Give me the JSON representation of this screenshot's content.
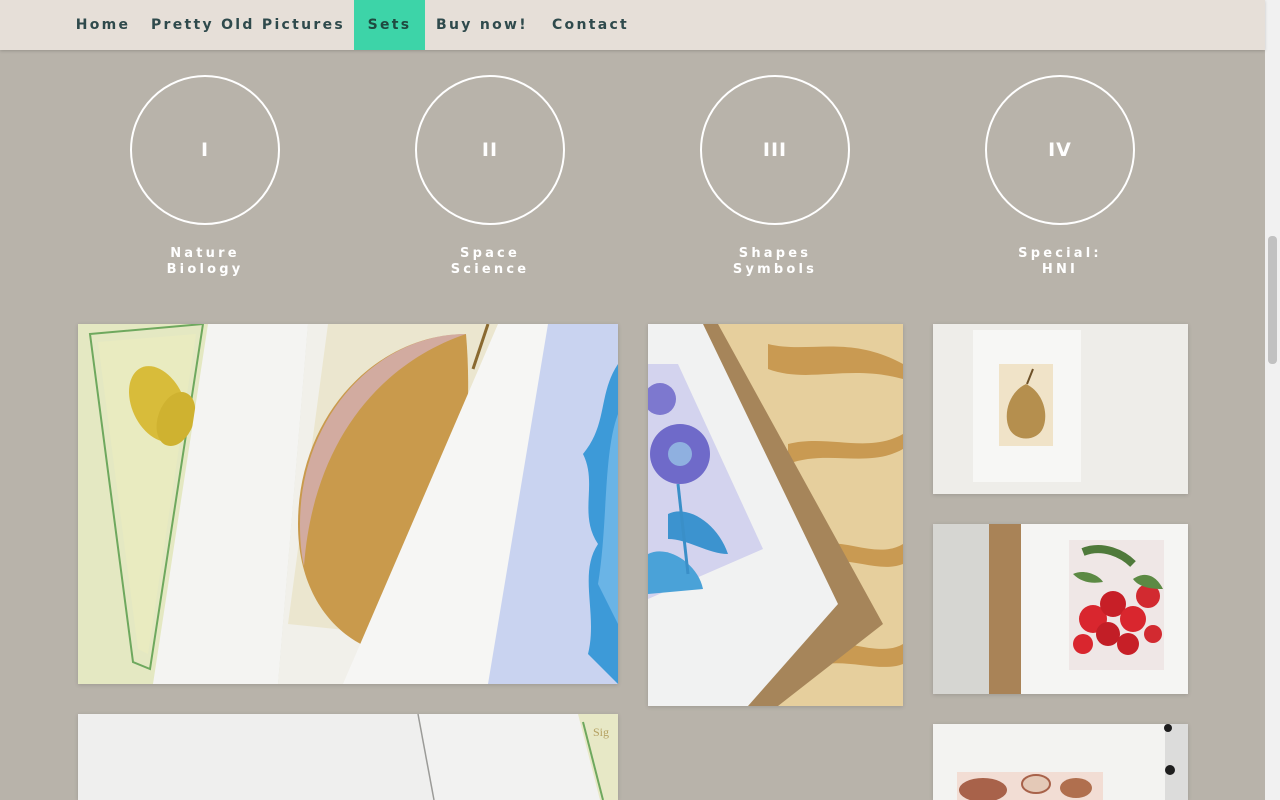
{
  "nav": {
    "items": [
      {
        "label": "Home"
      },
      {
        "label": "Pretty Old Pictures"
      },
      {
        "label": "Sets",
        "active": true
      },
      {
        "label": "Buy now!"
      },
      {
        "label": "Contact"
      }
    ]
  },
  "sets": [
    {
      "numeral": "I",
      "line1": "Nature",
      "line2": "Biology"
    },
    {
      "numeral": "II",
      "line1": "Space",
      "line2": "Science"
    },
    {
      "numeral": "III",
      "line1": "Shapes",
      "line2": "Symbols"
    },
    {
      "numeral": "IV",
      "line1": "Special:",
      "line2": "HNI"
    }
  ],
  "photos": [
    {
      "subject": "butterfly-and-pear-prints"
    },
    {
      "subject": "blue-flower-print-in-frame"
    },
    {
      "subject": "pear-print"
    },
    {
      "subject": "strawberry-print"
    },
    {
      "subject": "prints-closeup"
    },
    {
      "subject": "nuts-print"
    }
  ],
  "colors": {
    "background": "#b8b3aa",
    "nav_bg": "#e6dfd8",
    "nav_text": "#2f4a4c",
    "accent": "#3dd4a8",
    "circle_line": "#ffffff"
  }
}
